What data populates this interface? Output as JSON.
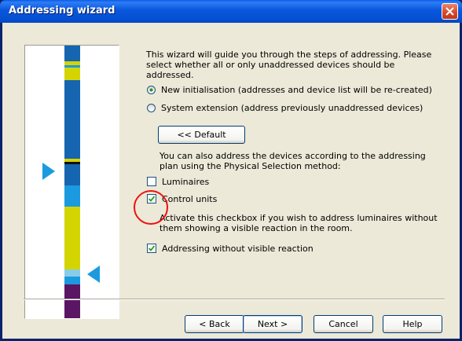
{
  "window": {
    "title": "Addressing wizard"
  },
  "intro_text": "This wizard will guide you through the steps of addressing. Please select whether all or only unaddressed devices should be addressed.",
  "mode_options": [
    {
      "label": "New initialisation (addresses and device list will be re-created)",
      "selected": true
    },
    {
      "label": "System extension (address previously unaddressed devices)",
      "selected": false
    }
  ],
  "default_button_label": "<< Default",
  "physical_selection_text": "You can also address the devices according to the addressing plan using the Physical Selection method:",
  "physical_selection_options": [
    {
      "label": "Luminaires",
      "checked": false
    },
    {
      "label": "Control units",
      "checked": true
    }
  ],
  "visible_reaction_text": "Activate this checkbox if you wish to address luminaires without them showing a visible reaction in the room.",
  "visible_reaction_option": {
    "label": "Addressing without visible reaction",
    "checked": true
  },
  "buttons": {
    "back": "< Back",
    "next": "Next >",
    "cancel": "Cancel",
    "help": "Help"
  },
  "colors": {
    "title_bar": "#0857DC",
    "dialog_bg": "#ECE9D8",
    "strip_blue": "#1565B0",
    "strip_yellow": "#D4D400",
    "strip_cyan": "#1B9AE0",
    "strip_purple": "#5A1663",
    "highlight_circle": "#E11111"
  }
}
